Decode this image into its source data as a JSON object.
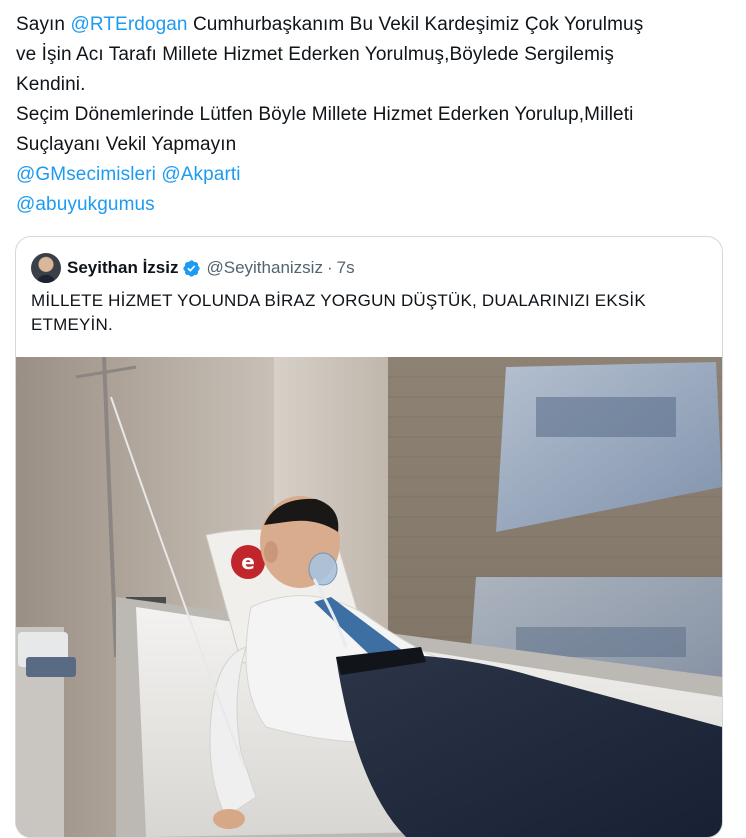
{
  "tweet": {
    "line1_prefix": "Sayın ",
    "line1_mention": "@RTErdogan",
    "line1_suffix": " Cumhurbaşkanım Bu Vekil Kardeşimiz Çok Yorulmuş",
    "line2": "ve İşin Acı Tarafı Millete Hizmet Ederken Yorulmuş,Böylede Sergilemiş",
    "line3": "Kendini.",
    "line4": "Seçim Dönemlerinde Lütfen Böyle Millete Hizmet Ederken Yorulup,Milleti",
    "line5": "Suçlayanı Vekil Yapmayın",
    "mentions_line1": [
      "@GMsecimisleri",
      "@Akparti"
    ],
    "mentions_line2": "@abuyukgumus"
  },
  "quoted_tweet": {
    "author_name": "Seyithan İzsiz",
    "handle": "@Seyithanizsiz",
    "separator": "·",
    "time": "7s",
    "text_line1": "MİLLETE HİZMET YOLUNDA BİRAZ YORGUN DÜŞTÜK, DUALARINIZI EKSİK",
    "text_line2": "ETMEYİN.",
    "verified_icon": "verified-badge-icon",
    "photo_logo_letter": "e"
  },
  "colors": {
    "link": "#1d9bf0",
    "text": "#0f1419",
    "secondary": "#536471",
    "border": "#cfd9de",
    "verified": "#1d9bf0"
  }
}
